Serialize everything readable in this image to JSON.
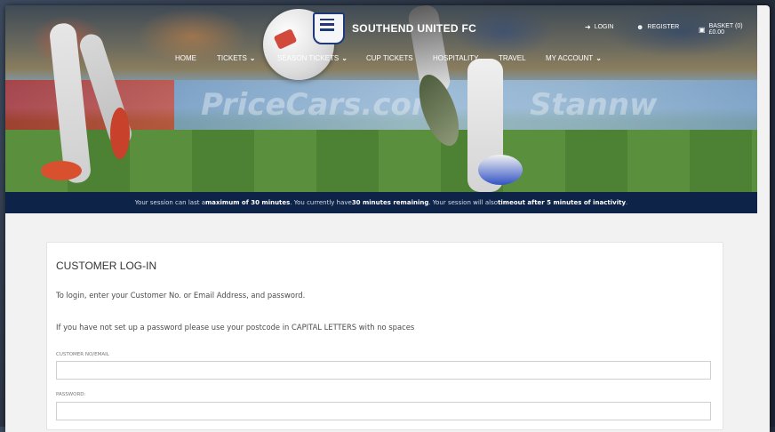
{
  "site": {
    "name": "SOUTHEND UNITED FC"
  },
  "utility_nav": {
    "login": "LOGIN",
    "register": "REGISTER",
    "basket": "BASKET (0) £0.00"
  },
  "main_nav": [
    {
      "label": "HOME",
      "has_dropdown": false
    },
    {
      "label": "TICKETS",
      "has_dropdown": true
    },
    {
      "label": "SEASON TICKETS",
      "has_dropdown": true
    },
    {
      "label": "CUP TICKETS",
      "has_dropdown": false
    },
    {
      "label": "HOSPITALITY",
      "has_dropdown": false
    },
    {
      "label": "TRAVEL",
      "has_dropdown": false
    },
    {
      "label": "MY ACCOUNT",
      "has_dropdown": true
    }
  ],
  "session": {
    "p1": "Your session can last a ",
    "b1": "maximum of 30 minutes",
    "p2": ". You currently have ",
    "b2": "30 minutes remaining",
    "p3": ". Your session will also ",
    "b3": "timeout after 5 minutes of inactivity",
    "p4": "."
  },
  "login": {
    "title": "CUSTOMER LOG-IN",
    "instructions": "To login, enter your Customer No. or Email Address, and password.",
    "postcode_note": "If you have not set up a password please use your postcode in CAPITAL LETTERS with no spaces",
    "customer_label": "CUSTOMER NO/EMAIL",
    "customer_value": "",
    "password_label": "PASSWORD:",
    "password_value": ""
  },
  "colors": {
    "session_bar": "#0e2348",
    "crest_blue": "#1f3a78"
  },
  "icons": {
    "login": "sign-in-icon",
    "register": "user-plus-icon",
    "basket": "basket-icon",
    "dropdown": "chevron-down-icon"
  }
}
